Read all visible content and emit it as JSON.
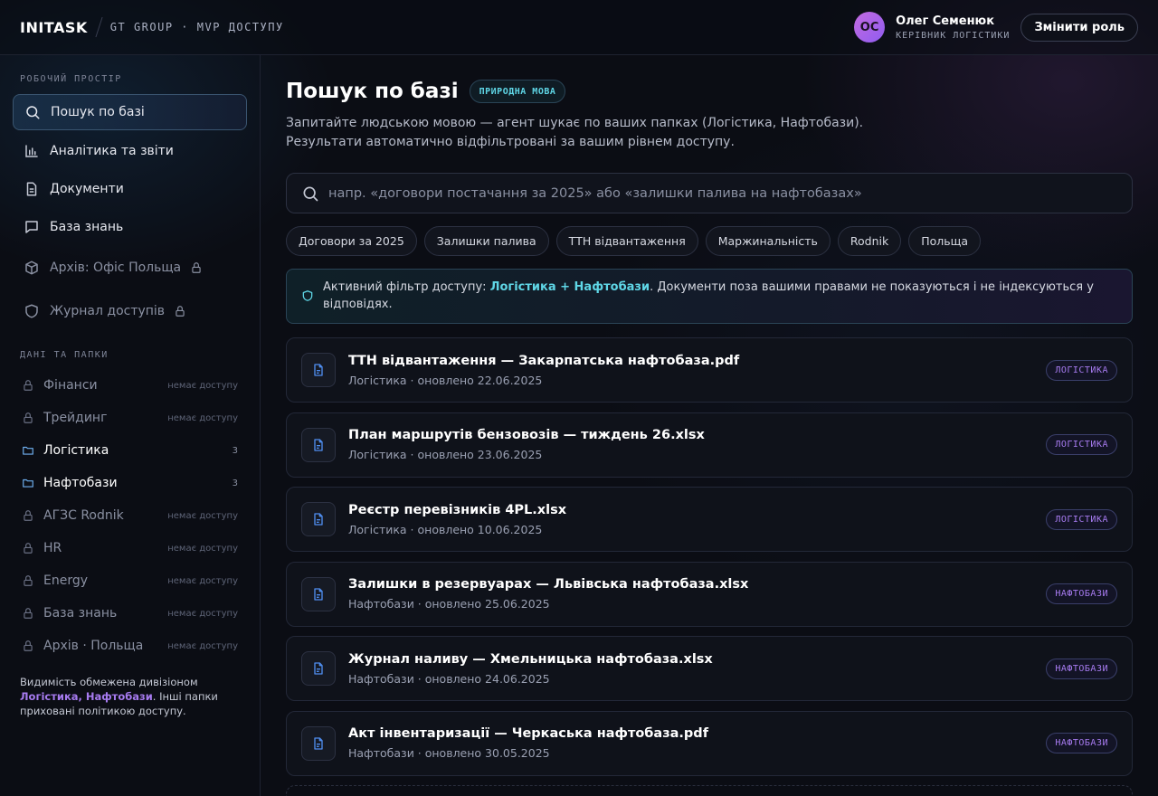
{
  "header": {
    "brand": "INITASK",
    "subtitle": "GT GROUP · MVP ДОСТУПУ",
    "user": {
      "initials": "ОС",
      "name": "Олег Семенюк",
      "role": "КЕРІВНИК ЛОГІСТИКИ"
    },
    "role_button": "Змінити роль"
  },
  "sidebar": {
    "workspace_label": "РОБОЧИЙ ПРОСТІР",
    "nav": [
      {
        "label": "Пошук по базі",
        "icon": "search-icon",
        "active": true,
        "locked": false
      },
      {
        "label": "Аналітика та звіти",
        "icon": "chart-icon",
        "active": false,
        "locked": false
      },
      {
        "label": "Документи",
        "icon": "document-icon",
        "active": false,
        "locked": false
      },
      {
        "label": "База знань",
        "icon": "chat-icon",
        "active": false,
        "locked": false
      },
      {
        "label": "Архів: Офіс Польща",
        "icon": "box-icon",
        "active": false,
        "locked": true
      },
      {
        "label": "Журнал доступів",
        "icon": "shield-icon",
        "active": false,
        "locked": true
      }
    ],
    "data_label": "ДАНІ ТА ПАПКИ",
    "folders": [
      {
        "label": "Фінанси",
        "meta": "немає доступу",
        "open": false
      },
      {
        "label": "Трейдинг",
        "meta": "немає доступу",
        "open": false
      },
      {
        "label": "Логістика",
        "meta": "3",
        "open": true
      },
      {
        "label": "Нафтобази",
        "meta": "3",
        "open": true
      },
      {
        "label": "АГЗС Rodnik",
        "meta": "немає доступу",
        "open": false
      },
      {
        "label": "HR",
        "meta": "немає доступу",
        "open": false
      },
      {
        "label": "Energy",
        "meta": "немає доступу",
        "open": false
      },
      {
        "label": "База знань",
        "meta": "немає доступу",
        "open": false
      },
      {
        "label": "Архів · Польща",
        "meta": "немає доступу",
        "open": false
      }
    ],
    "note_prefix": "Видимість обмежена дивізіоном",
    "note_highlight": "Логістика, Нафтобази",
    "note_suffix": ". Інші папки приховані політикою доступу."
  },
  "main": {
    "title": "Пошук по базі",
    "badge": "ПРИРОДНА МОВА",
    "subtitle_line1": "Запитайте людською мовою — агент шукає по ваших папках (Логістика, Нафтобази).",
    "subtitle_line2": "Результати автоматично відфільтровані за вашим рівнем доступу.",
    "search_placeholder": "напр. «договори постачання за 2025» або «залишки палива на нафтобазах»",
    "chips": [
      "Договори за 2025",
      "Залишки палива",
      "ТТН відвантаження",
      "Маржинальність",
      "Rodnik",
      "Польща"
    ],
    "filter": {
      "prefix": "Активний фільтр доступу: ",
      "highlight": "Логістика + Нафтобази",
      "suffix": ". Документи поза вашими правами не показуються і не індексуються у відповідях."
    },
    "results": [
      {
        "title": "ТТН відвантаження — Закарпатська нафтобаза.pdf",
        "meta": "Логістика · оновлено 22.06.2025",
        "tag": "ЛОГІСТИКА"
      },
      {
        "title": "План маршрутів бензовозів — тиждень 26.xlsx",
        "meta": "Логістика · оновлено 23.06.2025",
        "tag": "ЛОГІСТИКА"
      },
      {
        "title": "Реєстр перевізників 4PL.xlsx",
        "meta": "Логістика · оновлено 10.06.2025",
        "tag": "ЛОГІСТИКА"
      },
      {
        "title": "Залишки в резервуарах — Львівська нафтобаза.xlsx",
        "meta": "Нафтобази · оновлено 25.06.2025",
        "tag": "НАФТОБАЗИ"
      },
      {
        "title": "Журнал наливу — Хмельницька нафтобаза.xlsx",
        "meta": "Нафтобази · оновлено 24.06.2025",
        "tag": "НАФТОБАЗИ"
      },
      {
        "title": "Акт інвентаризації — Черкаська нафтобаза.pdf",
        "meta": "Нафтобази · оновлено 30.05.2025",
        "tag": "НАФТОБАЗИ"
      }
    ]
  },
  "colors": {
    "accent_cyan": "#5fd6e6",
    "accent_purple": "#a77bf0",
    "file_icon_blue": "#4f8ef0",
    "folder_icon_blue": "#6fb0f0"
  }
}
